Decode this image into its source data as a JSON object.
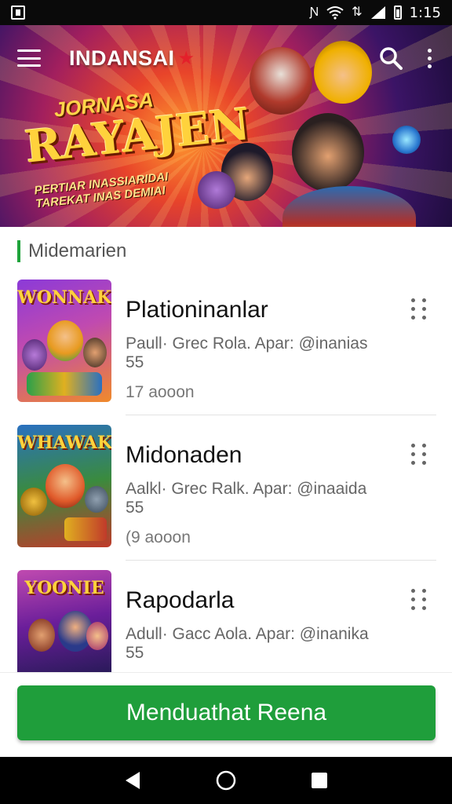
{
  "status_bar": {
    "time": "1:15"
  },
  "app": {
    "title": "INDANSAI"
  },
  "banner": {
    "headline_top": "JORNASA",
    "headline_main": "RAYAJEN",
    "subline_1": "PERTIAR INASSIARIDAI",
    "subline_2": "TAREKAT INAS DEMIAI"
  },
  "section": {
    "label": "Midemarien"
  },
  "games": [
    {
      "thumb_text": "WONNAK",
      "title": "Plationinanlar",
      "desc_line1": "Paull· Grec Rola. Apar: @inanias",
      "desc_line2": "55",
      "meta": "17 aooon",
      "colors": {
        "bg": "#7a2fd0",
        "accent": "#28b34b"
      }
    },
    {
      "thumb_text": "WHAWAK",
      "title": "Midonaden",
      "desc_line1": "Aalkl· Grec Ralk. Apar: @inaaida",
      "desc_line2": "55",
      "meta": "(9 aooon",
      "colors": {
        "bg": "#3a8b3e",
        "accent": "#e63a2d"
      }
    },
    {
      "thumb_text": "YOONIE",
      "title": "Rapodarla",
      "desc_line1": "Adull· Gacc Aola. Apar: @inanika",
      "desc_line2": "55",
      "meta": "",
      "colors": {
        "bg": "#8a1f9a",
        "accent": "#f0a020"
      }
    }
  ],
  "cta": {
    "label": "Menduathat Reena"
  },
  "theme": {
    "primary": "#1f9e3b",
    "status_bar": "#0a0a0a"
  }
}
